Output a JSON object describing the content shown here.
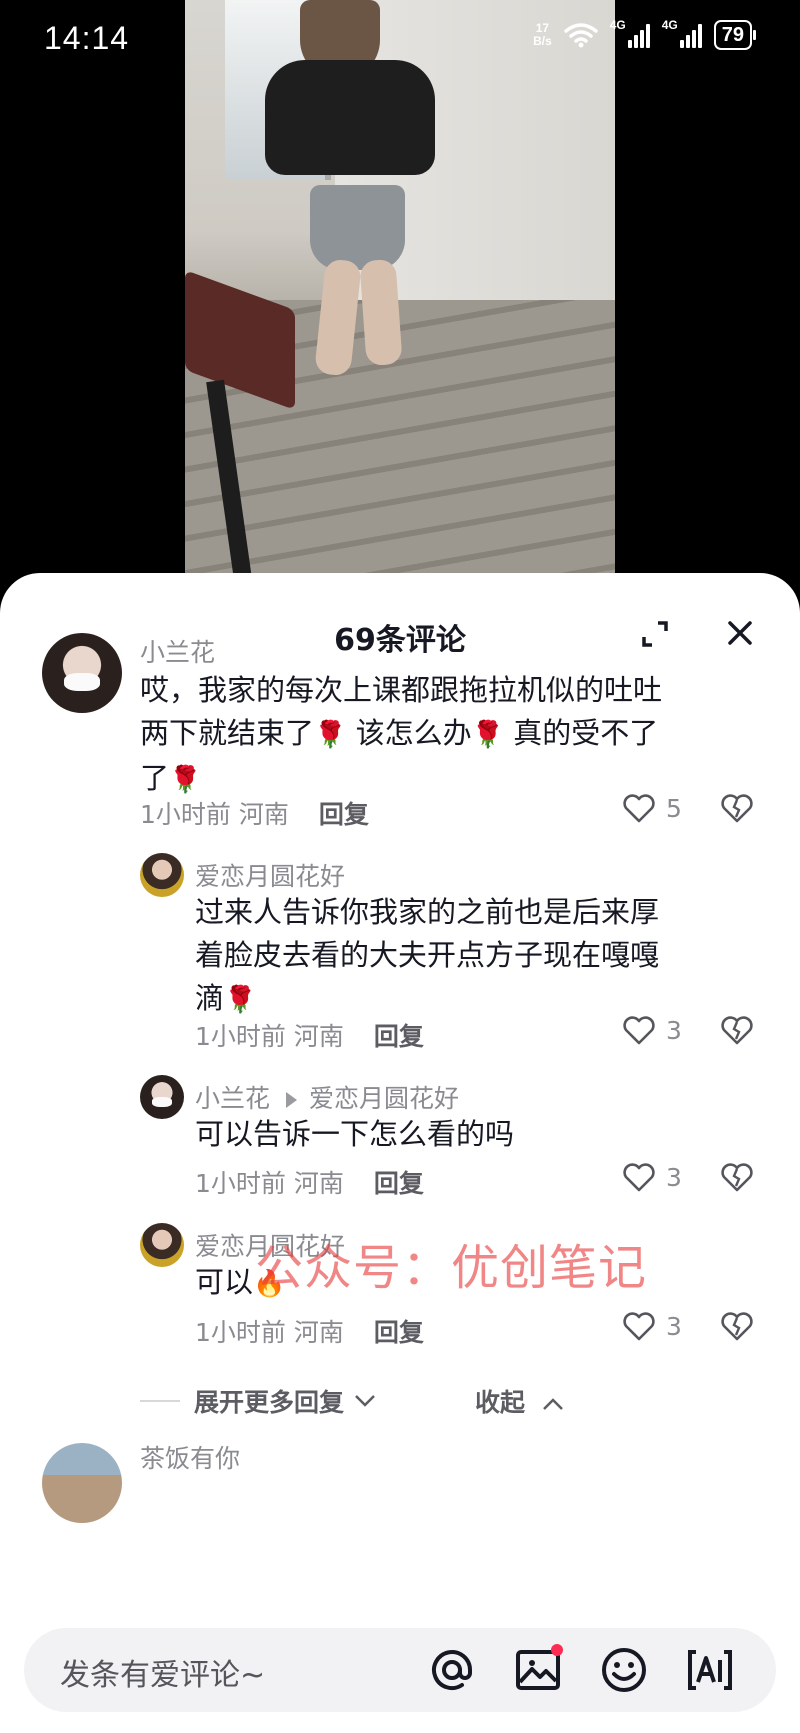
{
  "status_bar": {
    "time": "14:14",
    "net_speed_value": "17",
    "net_speed_unit": "B/s",
    "sim1_tag": "4G",
    "sim2_tag": "4G",
    "battery": "79"
  },
  "sheet": {
    "title": "69条评论"
  },
  "comments": [
    {
      "user": "小兰花",
      "line1": "哎，我家的每次上课都跟拖拉机似的吐吐",
      "line2a": "两下就结束了",
      "line2b": " 该怎么办",
      "line2c": " 真的受不了",
      "line3": "了",
      "time": "1小时前 河南",
      "reply": "回复",
      "likes": "5"
    },
    {
      "user": "爱恋月圆花好",
      "line1": "过来人告诉你我家的之前也是后来厚",
      "line2": "着脸皮去看的大夫开点方子现在嘎嘎",
      "line3": "滴",
      "time": "1小时前 河南",
      "reply": "回复",
      "likes": "3"
    },
    {
      "user": "小兰花",
      "reply_to": "爱恋月圆花好",
      "text": "可以告诉一下怎么看的吗",
      "time": "1小时前 河南",
      "reply": "回复",
      "likes": "3"
    },
    {
      "user": "爱恋月圆花好",
      "text": "可以",
      "time": "1小时前 河南",
      "reply": "回复",
      "likes": "3"
    }
  ],
  "expand_more": "展开更多回复",
  "collapse": "收起",
  "next_user": "茶饭有你",
  "watermark": "公众号：优创笔记",
  "input": {
    "placeholder": "发条有爱评论~"
  },
  "emoji": {
    "rose": "🌹",
    "fire": "🔥"
  },
  "icons": [
    "expand-icon",
    "close-icon",
    "heart-icon",
    "broken-heart-icon",
    "at-icon",
    "image-icon",
    "emoji-icon",
    "ai-icon"
  ]
}
